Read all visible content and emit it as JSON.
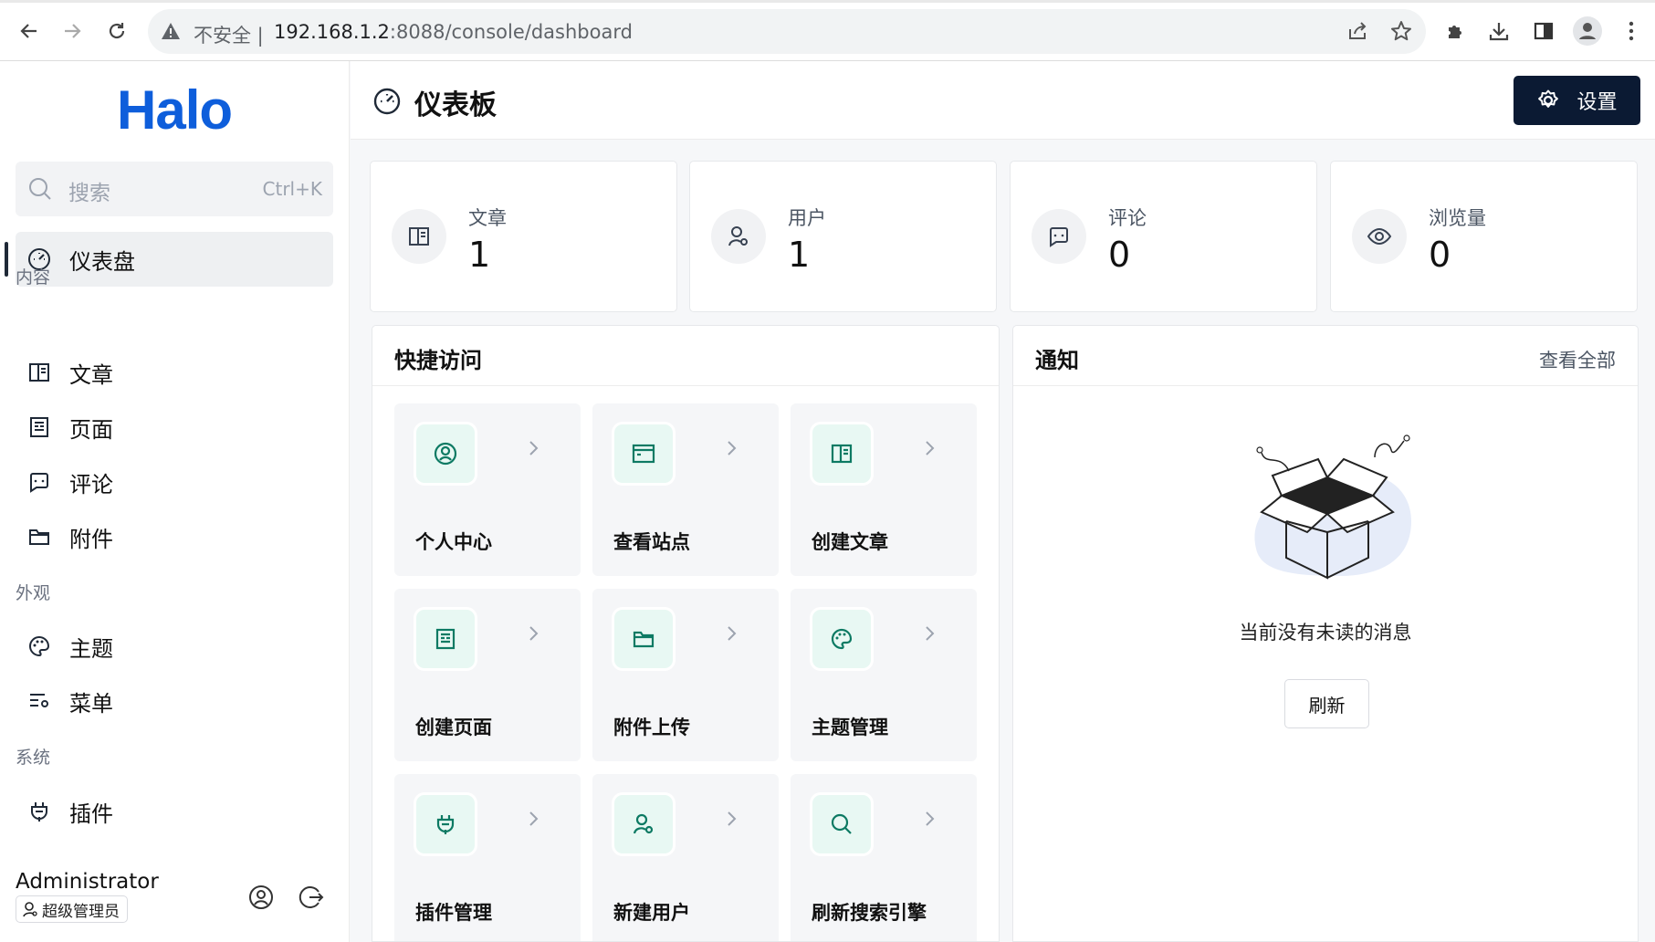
{
  "browser": {
    "insecure_label": "不安全",
    "url_host": "192.168.1.2",
    "url_rest": ":8088/console/dashboard"
  },
  "sidebar": {
    "logo": "Halo",
    "search": {
      "placeholder": "搜索",
      "shortcut": "Ctrl+K"
    },
    "dashboard_label": "仪表盘",
    "sections": {
      "content": "内容",
      "appearance": "外观",
      "system": "系统"
    },
    "items": {
      "posts": "文章",
      "pages": "页面",
      "comments": "评论",
      "attachments": "附件",
      "themes": "主题",
      "menus": "菜单",
      "plugins": "插件"
    },
    "user": {
      "name": "Administrator",
      "role": "超级管理员"
    }
  },
  "header": {
    "title": "仪表板",
    "settings_label": "设置"
  },
  "stats": [
    {
      "label": "文章",
      "value": "1",
      "icon": "book-icon"
    },
    {
      "label": "用户",
      "value": "1",
      "icon": "user-gear-icon"
    },
    {
      "label": "评论",
      "value": "0",
      "icon": "comment-icon"
    },
    {
      "label": "浏览量",
      "value": "0",
      "icon": "eye-icon"
    }
  ],
  "quick_access": {
    "title": "快捷访问",
    "items": [
      {
        "label": "个人中心",
        "icon": "user-circle-icon"
      },
      {
        "label": "查看站点",
        "icon": "browser-window-icon"
      },
      {
        "label": "创建文章",
        "icon": "book-icon"
      },
      {
        "label": "创建页面",
        "icon": "page-icon"
      },
      {
        "label": "附件上传",
        "icon": "folder-icon"
      },
      {
        "label": "主题管理",
        "icon": "palette-icon"
      },
      {
        "label": "插件管理",
        "icon": "plug-icon"
      },
      {
        "label": "新建用户",
        "icon": "user-gear-icon"
      },
      {
        "label": "刷新搜索引擎",
        "icon": "search-icon"
      }
    ]
  },
  "notifications": {
    "title": "通知",
    "view_all": "查看全部",
    "empty_text": "当前没有未读的消息",
    "refresh_label": "刷新"
  }
}
